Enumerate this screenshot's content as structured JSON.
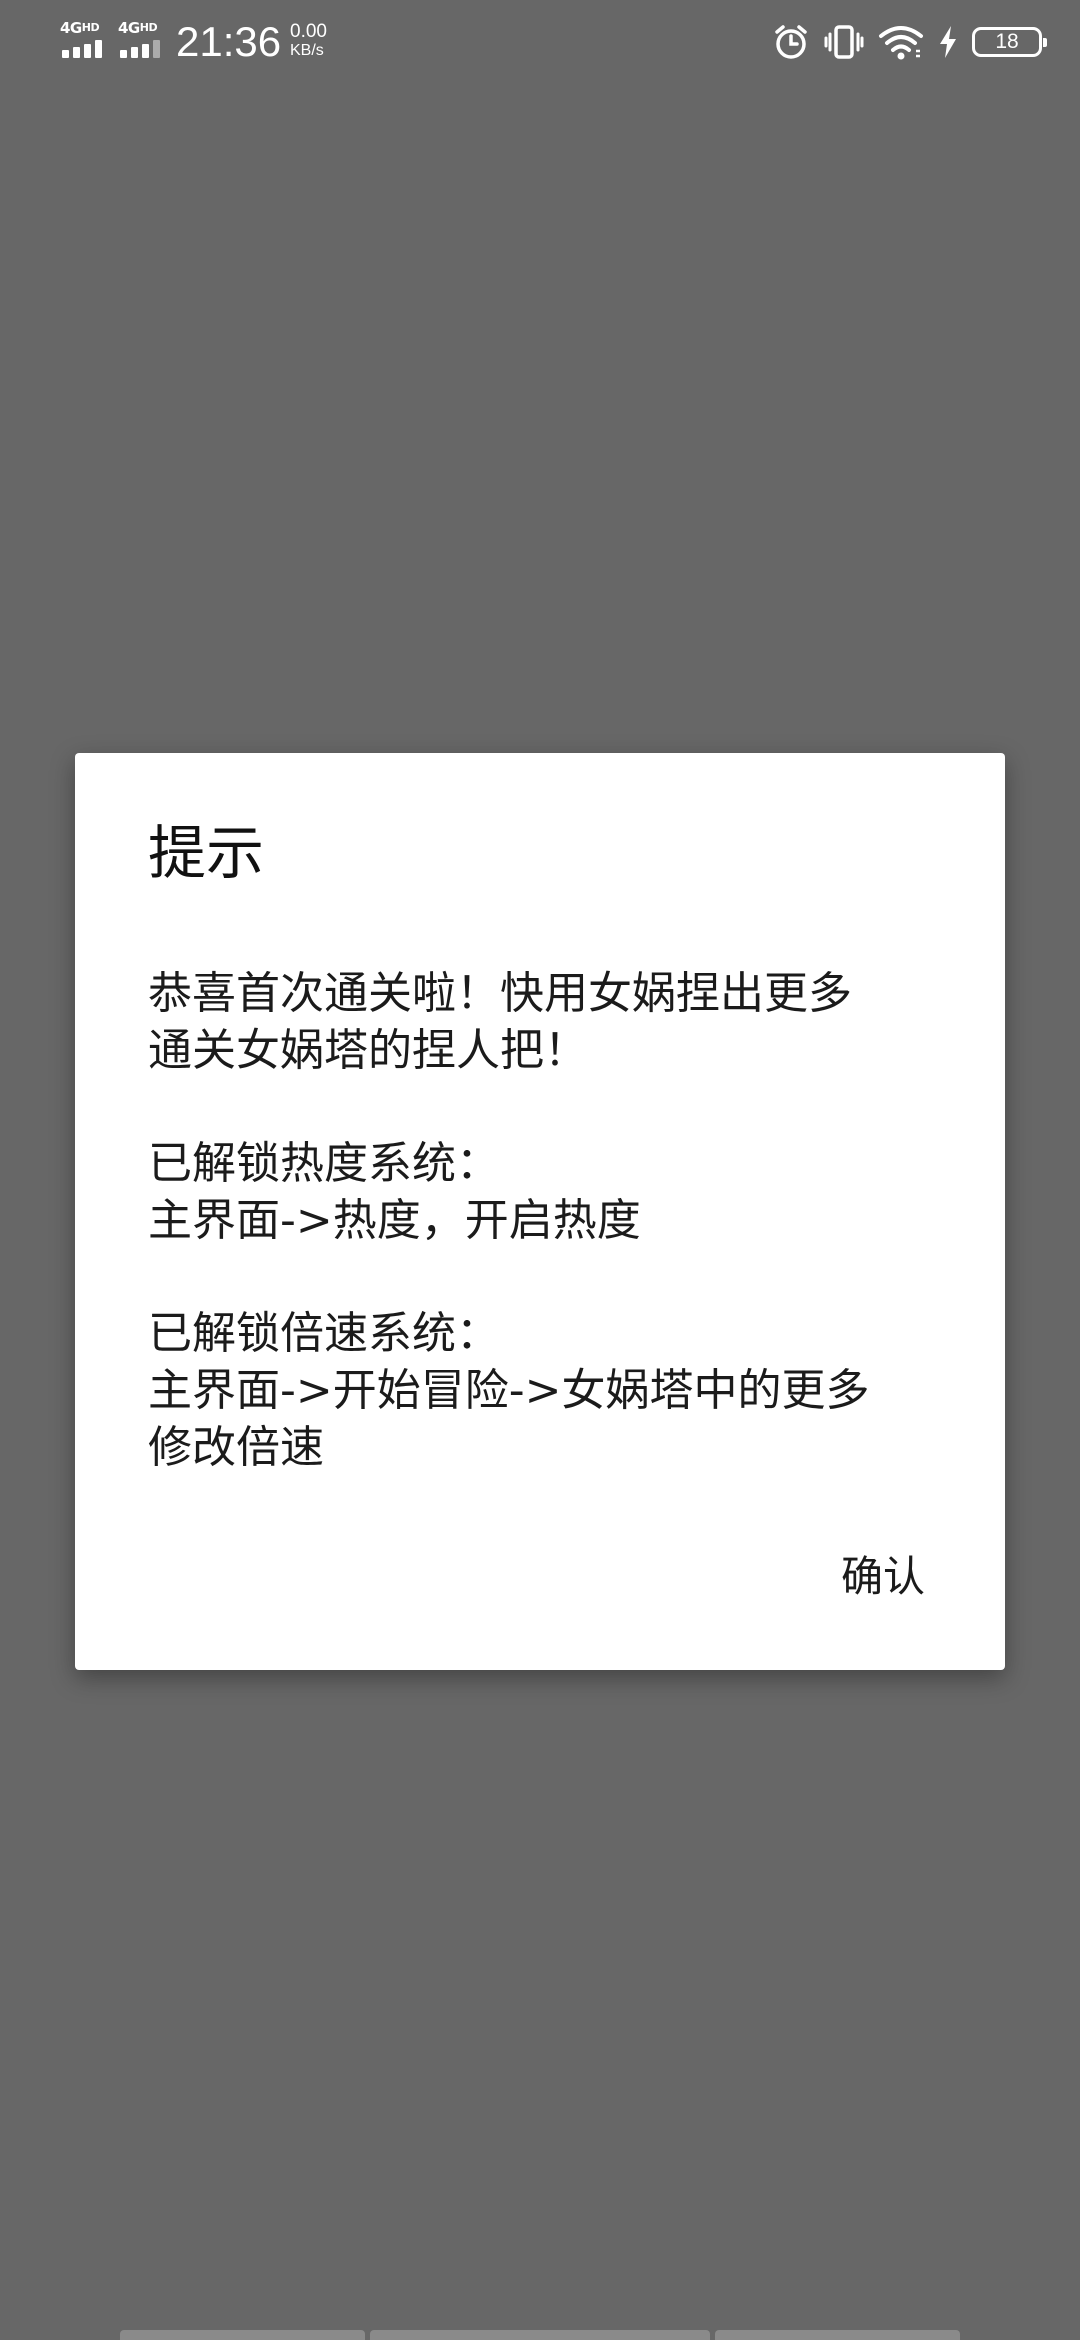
{
  "status_bar": {
    "network_1": "4G",
    "network_1_sup": "HD",
    "network_2": "4G",
    "network_2_sup": "HD",
    "time": "21:36",
    "speed_value": "0.00",
    "speed_unit": "KB/s",
    "battery_level": "18",
    "icons": [
      "alarm-icon",
      "vibrate-icon",
      "wifi-icon",
      "charging-icon",
      "battery-icon"
    ]
  },
  "dialog": {
    "title": "提示",
    "paragraphs": [
      "恭喜首次通关啦！快用女娲捏出更多\n通关女娲塔的捏人把！",
      "已解锁热度系统：\n主界面->热度，开启热度",
      "已解锁倍速系统：\n主界面->开始冒险->女娲塔中的更多\n修改倍速"
    ],
    "confirm_label": "确认"
  },
  "colors": {
    "backdrop": "#676767",
    "dialog_bg": "#ffffff",
    "text": "#1b1b1b"
  }
}
